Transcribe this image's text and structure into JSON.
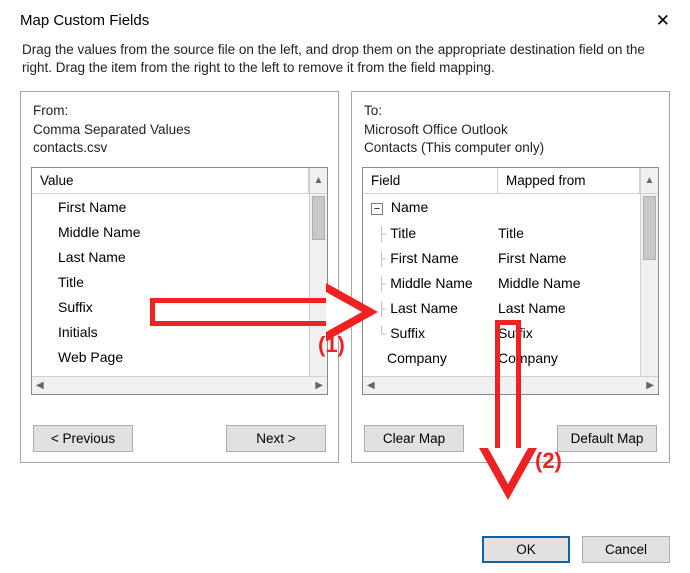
{
  "title": "Map Custom Fields",
  "close_glyph": "✕",
  "instructions": "Drag the values from the source file on the left, and drop them on the appropriate destination field on the right.  Drag the item from the right to the left to remove it from the field mapping.",
  "from": {
    "heading": "From:",
    "source_type": "Comma Separated Values",
    "filename": "contacts.csv",
    "column_header": "Value",
    "items": [
      "First Name",
      "Middle Name",
      "Last Name",
      "Title",
      "Suffix",
      "Initials",
      "Web Page"
    ],
    "buttons": {
      "previous": "< Previous",
      "next": "Next >"
    }
  },
  "to": {
    "heading": "To:",
    "target_app": "Microsoft Office Outlook",
    "folder": "Contacts (This computer only)",
    "column_field": "Field",
    "column_mapped": "Mapped from",
    "root_label": "Name",
    "rows": [
      {
        "field": "Title",
        "mapped": "Title"
      },
      {
        "field": "First Name",
        "mapped": "First Name"
      },
      {
        "field": "Middle Name",
        "mapped": "Middle Name"
      },
      {
        "field": "Last Name",
        "mapped": "Last Name"
      },
      {
        "field": "Suffix",
        "mapped": "Suffix"
      },
      {
        "field": "Company",
        "mapped": "Company"
      }
    ],
    "buttons": {
      "clear": "Clear Map",
      "default": "Default Map"
    }
  },
  "footer": {
    "ok": "OK",
    "cancel": "Cancel"
  },
  "annotations": {
    "label1": "(1)",
    "label2": "(2)"
  }
}
